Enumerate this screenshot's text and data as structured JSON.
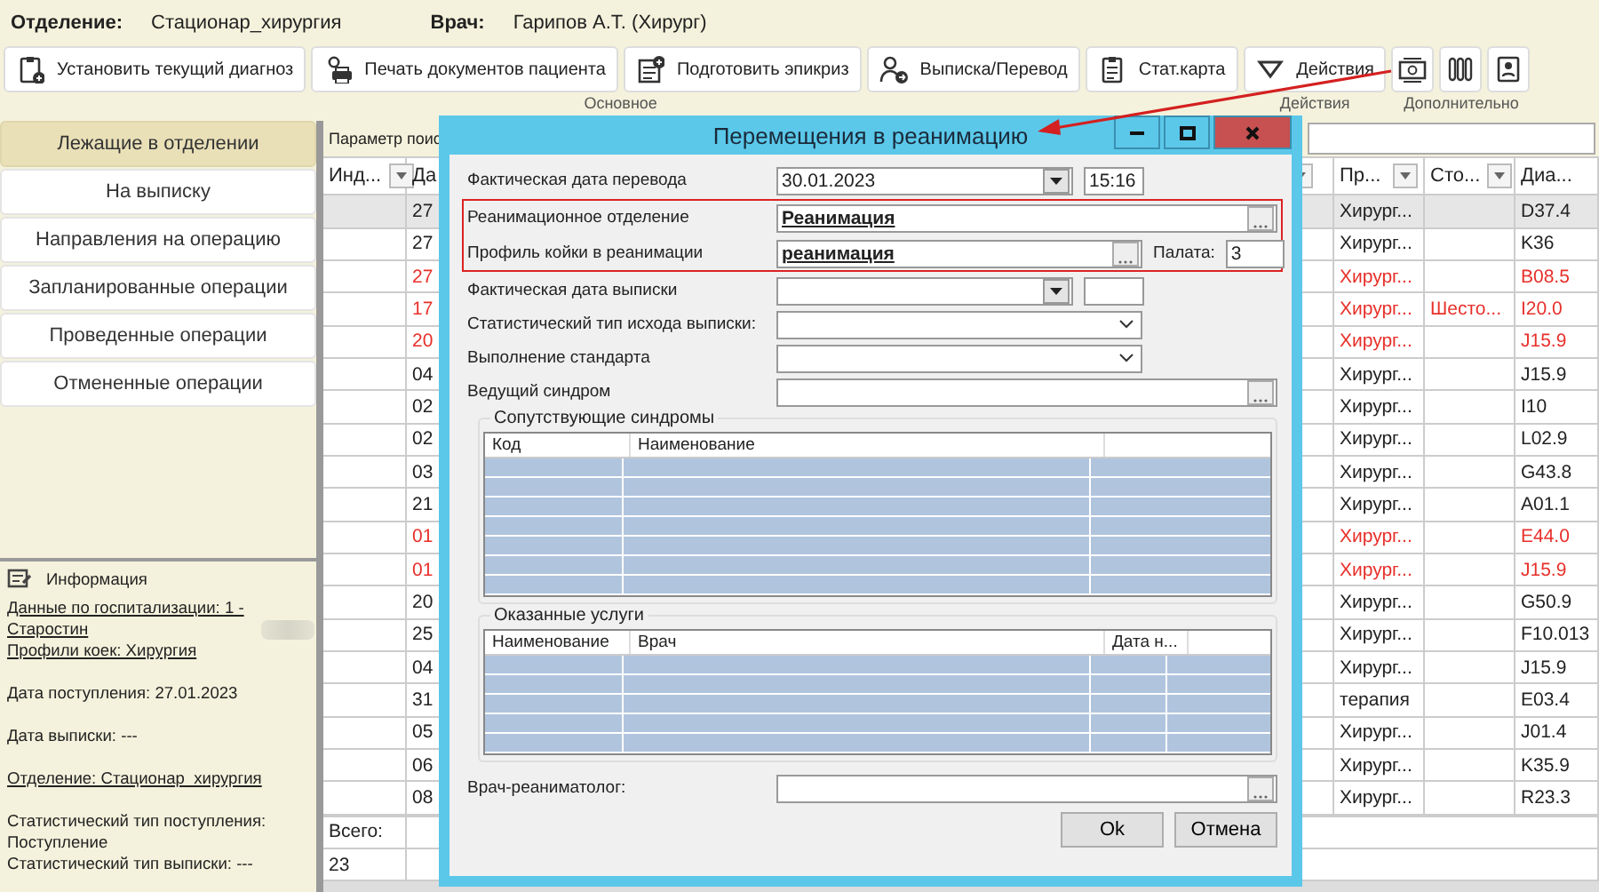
{
  "header": {
    "department_label": "Отделение:",
    "department": "Стационар_хирургия",
    "doctor_label": "Врач:",
    "doctor": "Гарипов А.Т. (Хирург)"
  },
  "toolbar": {
    "groups": [
      {
        "label": "Основное",
        "buttons": [
          {
            "kind": "labeled",
            "label": "Установить текущий диагноз"
          },
          {
            "kind": "labeled",
            "label": "Печать документов пациента"
          },
          {
            "kind": "labeled",
            "label": "Подготовить эпикриз"
          },
          {
            "kind": "labeled",
            "label": "Выписка/Перевод"
          },
          {
            "kind": "labeled",
            "label": "Стат.карта"
          }
        ]
      },
      {
        "label": "Действия",
        "buttons": [
          {
            "kind": "labeled",
            "label": "Действия"
          }
        ]
      },
      {
        "label": "Дополнительно",
        "buttons": [
          {
            "kind": "icon"
          },
          {
            "kind": "icon"
          },
          {
            "kind": "icon"
          }
        ]
      }
    ]
  },
  "sidebar": {
    "items": [
      {
        "label": "Лежащие в отделении",
        "selected": true
      },
      {
        "label": "На выписку",
        "selected": false
      },
      {
        "label": "Направления на операцию",
        "selected": false
      },
      {
        "label": "Запланированные операции",
        "selected": false
      },
      {
        "label": "Проведенные операции",
        "selected": false
      },
      {
        "label": "Отмененные операции",
        "selected": false
      }
    ]
  },
  "info": {
    "title": "Информация",
    "lines": [
      {
        "text": "Данные по госпитализации: 1 - Старостин",
        "link": true,
        "redacted": true
      },
      {
        "text": "Профили коек: Хирургия",
        "link": true,
        "redacted": false
      },
      {
        "text": "Дата поступления: 27.01.2023",
        "link": false,
        "redacted": false
      },
      {
        "text": "Дата выписки: ---",
        "link": false,
        "redacted": false
      },
      {
        "text": "Отделение: Стационар_хирургия",
        "link": true,
        "redacted": false
      },
      {
        "text": "Статистический тип поступления: Поступление",
        "link": false,
        "redacted": false
      },
      {
        "text": "Статистический тип выписки: ---",
        "link": false,
        "redacted": false
      }
    ]
  },
  "table": {
    "search_label": "Параметр поис",
    "columns": [
      "Инд...",
      "Да",
      "Пр...",
      "Сто...",
      "Диа..."
    ],
    "rows": [
      {
        "cells": [
          null,
          "27",
          "Хирург...",
          null,
          "D37.4"
        ],
        "red": false,
        "selected": true
      },
      {
        "cells": [
          null,
          "27",
          "Хирург...",
          null,
          "K36"
        ],
        "red": false,
        "selected": false
      },
      {
        "cells": [
          null,
          "27",
          "Хирург...",
          null,
          "B08.5"
        ],
        "red": true,
        "selected": false
      },
      {
        "cells": [
          null,
          "17",
          "Хирург...",
          "Шесто...",
          "I20.0"
        ],
        "red": true,
        "selected": false
      },
      {
        "cells": [
          null,
          "20",
          "Хирург...",
          null,
          "J15.9"
        ],
        "red": true,
        "selected": false
      },
      {
        "cells": [
          null,
          "04",
          "Хирург...",
          null,
          "J15.9"
        ],
        "red": false,
        "selected": false
      },
      {
        "cells": [
          null,
          "02",
          "Хирург...",
          null,
          "I10"
        ],
        "red": false,
        "selected": false
      },
      {
        "cells": [
          null,
          "02",
          "Хирург...",
          null,
          "L02.9"
        ],
        "red": false,
        "selected": false
      },
      {
        "cells": [
          null,
          "03",
          "Хирург...",
          null,
          "G43.8"
        ],
        "red": false,
        "selected": false
      },
      {
        "cells": [
          null,
          "21",
          "Хирург...",
          null,
          "A01.1"
        ],
        "red": false,
        "selected": false
      },
      {
        "cells": [
          null,
          "01",
          "Хирург...",
          null,
          "E44.0"
        ],
        "red": true,
        "selected": false
      },
      {
        "cells": [
          null,
          "01",
          "Хирург...",
          null,
          "J15.9"
        ],
        "red": true,
        "selected": false
      },
      {
        "cells": [
          null,
          "20",
          "Хирург...",
          null,
          "G50.9"
        ],
        "red": false,
        "selected": false
      },
      {
        "cells": [
          null,
          "25",
          "Хирург...",
          null,
          "F10.013"
        ],
        "red": false,
        "selected": false
      },
      {
        "cells": [
          null,
          "04",
          "Хирург...",
          null,
          "J15.9"
        ],
        "red": false,
        "selected": false
      },
      {
        "cells": [
          null,
          "31",
          "терапия",
          null,
          "E03.4"
        ],
        "red": false,
        "selected": false
      },
      {
        "cells": [
          null,
          "05",
          "Хирург...",
          null,
          "J01.4"
        ],
        "red": false,
        "selected": false
      },
      {
        "cells": [
          null,
          "06",
          "Хирург...",
          null,
          "K35.9"
        ],
        "red": false,
        "selected": false
      },
      {
        "cells": [
          null,
          "08",
          "Хирург...",
          null,
          "R23.3"
        ],
        "red": false,
        "selected": false
      }
    ],
    "total_label": "Всего:",
    "total": "23"
  },
  "dialog": {
    "title": "Перемещения в реанимацию",
    "fields": [
      {
        "label": "Фактическая дата перевода",
        "kind": "date",
        "value": "30.01.2023",
        "time": "15:16",
        "highlighted": false
      },
      {
        "label": "Реанимационное отделение",
        "kind": "lookup",
        "value": "Реанимация",
        "highlighted": true
      },
      {
        "label": "Профиль койки в реанимации",
        "kind": "lookup",
        "value": "реанимация",
        "room_label": "Палата:",
        "room": "3",
        "highlighted": true
      },
      {
        "label": "Фактическая дата выписки",
        "kind": "date",
        "highlighted": false
      },
      {
        "label": "Статистический тип исхода выписки:",
        "kind": "combo",
        "highlighted": false
      },
      {
        "label": "Выполнение стандарта",
        "kind": "combo",
        "highlighted": false
      },
      {
        "label": "Ведущий синдром",
        "kind": "lookup",
        "highlighted": false
      }
    ],
    "grids": [
      {
        "title": "Сопутствующие синдромы",
        "columns": [
          "Код",
          "Наименование"
        ]
      },
      {
        "title": "Оказанные услуги",
        "columns": [
          "Наименование",
          "Врач",
          "Дата н..."
        ]
      }
    ],
    "doctor_field": {
      "label": "Врач-реаниматолог:",
      "kind": "lookup"
    },
    "buttons": [
      "Ok",
      "Отмена"
    ]
  }
}
